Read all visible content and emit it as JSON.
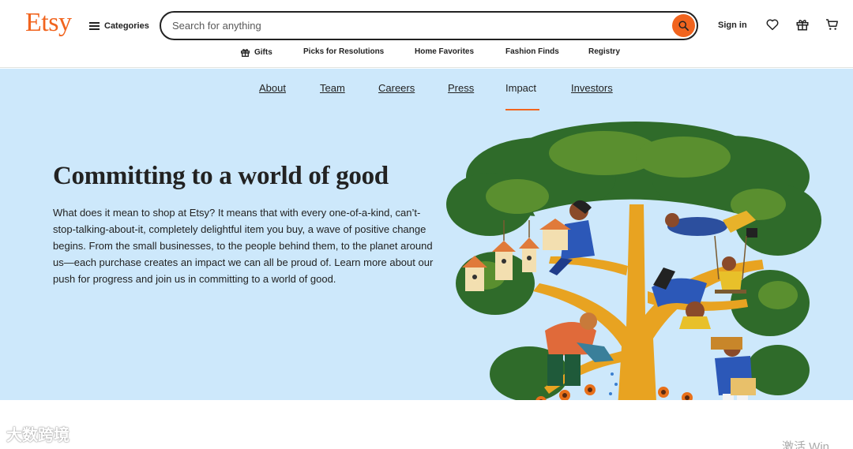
{
  "header": {
    "logo": "Etsy",
    "categories_label": "Categories",
    "search_placeholder": "Search for anything",
    "signin_label": "Sign in",
    "icons": [
      "search-icon",
      "heart-icon",
      "gift-icon",
      "cart-icon"
    ]
  },
  "subnav": {
    "items": [
      {
        "label": "Gifts",
        "icon": "gift-icon"
      },
      {
        "label": "Picks for Resolutions"
      },
      {
        "label": "Home Favorites"
      },
      {
        "label": "Fashion Finds"
      },
      {
        "label": "Registry"
      }
    ]
  },
  "about_nav": {
    "links": [
      "About",
      "Team",
      "Careers",
      "Press",
      "Impact",
      "Investors"
    ],
    "active": "Impact"
  },
  "hero": {
    "headline": "Committing to a world of good",
    "body": "What does it mean to shop at Etsy? It means that with every one-of-a-kind, can’t-stop-talking-about-it, completely delightful item you buy, a wave of positive change begins. From the small businesses, to the people behind them, to the planet around us—each purchase creates an impact we can all be proud of. Learn more about our push for progress and join us in committing to a world of good.",
    "illustration": "tree-with-people-illustration"
  },
  "overlay": {
    "watermark": "大数跨境",
    "windows_text": "激活 Win"
  },
  "colors": {
    "brand_orange": "#f1641e",
    "hero_bg": "#cde8fb",
    "text": "#222222"
  }
}
